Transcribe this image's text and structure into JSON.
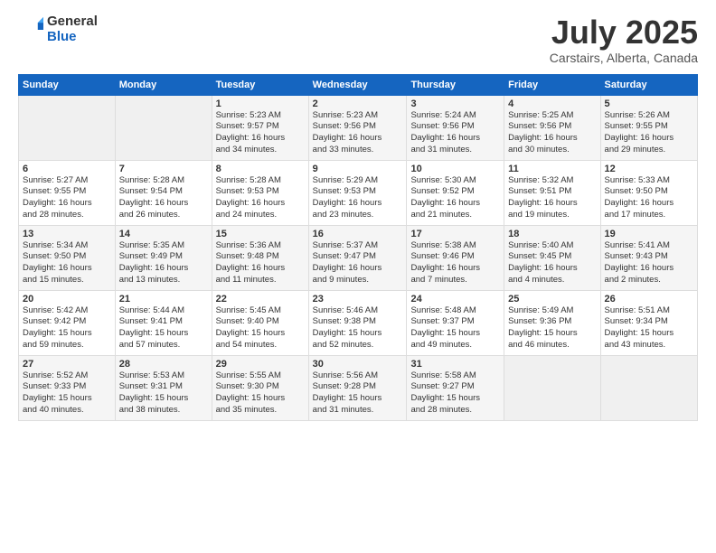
{
  "header": {
    "logo_general": "General",
    "logo_blue": "Blue",
    "title": "July 2025",
    "subtitle": "Carstairs, Alberta, Canada"
  },
  "calendar": {
    "days_of_week": [
      "Sunday",
      "Monday",
      "Tuesday",
      "Wednesday",
      "Thursday",
      "Friday",
      "Saturday"
    ],
    "weeks": [
      [
        {
          "day": "",
          "info": ""
        },
        {
          "day": "",
          "info": ""
        },
        {
          "day": "1",
          "info": "Sunrise: 5:23 AM\nSunset: 9:57 PM\nDaylight: 16 hours\nand 34 minutes."
        },
        {
          "day": "2",
          "info": "Sunrise: 5:23 AM\nSunset: 9:56 PM\nDaylight: 16 hours\nand 33 minutes."
        },
        {
          "day": "3",
          "info": "Sunrise: 5:24 AM\nSunset: 9:56 PM\nDaylight: 16 hours\nand 31 minutes."
        },
        {
          "day": "4",
          "info": "Sunrise: 5:25 AM\nSunset: 9:56 PM\nDaylight: 16 hours\nand 30 minutes."
        },
        {
          "day": "5",
          "info": "Sunrise: 5:26 AM\nSunset: 9:55 PM\nDaylight: 16 hours\nand 29 minutes."
        }
      ],
      [
        {
          "day": "6",
          "info": "Sunrise: 5:27 AM\nSunset: 9:55 PM\nDaylight: 16 hours\nand 28 minutes."
        },
        {
          "day": "7",
          "info": "Sunrise: 5:28 AM\nSunset: 9:54 PM\nDaylight: 16 hours\nand 26 minutes."
        },
        {
          "day": "8",
          "info": "Sunrise: 5:28 AM\nSunset: 9:53 PM\nDaylight: 16 hours\nand 24 minutes."
        },
        {
          "day": "9",
          "info": "Sunrise: 5:29 AM\nSunset: 9:53 PM\nDaylight: 16 hours\nand 23 minutes."
        },
        {
          "day": "10",
          "info": "Sunrise: 5:30 AM\nSunset: 9:52 PM\nDaylight: 16 hours\nand 21 minutes."
        },
        {
          "day": "11",
          "info": "Sunrise: 5:32 AM\nSunset: 9:51 PM\nDaylight: 16 hours\nand 19 minutes."
        },
        {
          "day": "12",
          "info": "Sunrise: 5:33 AM\nSunset: 9:50 PM\nDaylight: 16 hours\nand 17 minutes."
        }
      ],
      [
        {
          "day": "13",
          "info": "Sunrise: 5:34 AM\nSunset: 9:50 PM\nDaylight: 16 hours\nand 15 minutes."
        },
        {
          "day": "14",
          "info": "Sunrise: 5:35 AM\nSunset: 9:49 PM\nDaylight: 16 hours\nand 13 minutes."
        },
        {
          "day": "15",
          "info": "Sunrise: 5:36 AM\nSunset: 9:48 PM\nDaylight: 16 hours\nand 11 minutes."
        },
        {
          "day": "16",
          "info": "Sunrise: 5:37 AM\nSunset: 9:47 PM\nDaylight: 16 hours\nand 9 minutes."
        },
        {
          "day": "17",
          "info": "Sunrise: 5:38 AM\nSunset: 9:46 PM\nDaylight: 16 hours\nand 7 minutes."
        },
        {
          "day": "18",
          "info": "Sunrise: 5:40 AM\nSunset: 9:45 PM\nDaylight: 16 hours\nand 4 minutes."
        },
        {
          "day": "19",
          "info": "Sunrise: 5:41 AM\nSunset: 9:43 PM\nDaylight: 16 hours\nand 2 minutes."
        }
      ],
      [
        {
          "day": "20",
          "info": "Sunrise: 5:42 AM\nSunset: 9:42 PM\nDaylight: 15 hours\nand 59 minutes."
        },
        {
          "day": "21",
          "info": "Sunrise: 5:44 AM\nSunset: 9:41 PM\nDaylight: 15 hours\nand 57 minutes."
        },
        {
          "day": "22",
          "info": "Sunrise: 5:45 AM\nSunset: 9:40 PM\nDaylight: 15 hours\nand 54 minutes."
        },
        {
          "day": "23",
          "info": "Sunrise: 5:46 AM\nSunset: 9:38 PM\nDaylight: 15 hours\nand 52 minutes."
        },
        {
          "day": "24",
          "info": "Sunrise: 5:48 AM\nSunset: 9:37 PM\nDaylight: 15 hours\nand 49 minutes."
        },
        {
          "day": "25",
          "info": "Sunrise: 5:49 AM\nSunset: 9:36 PM\nDaylight: 15 hours\nand 46 minutes."
        },
        {
          "day": "26",
          "info": "Sunrise: 5:51 AM\nSunset: 9:34 PM\nDaylight: 15 hours\nand 43 minutes."
        }
      ],
      [
        {
          "day": "27",
          "info": "Sunrise: 5:52 AM\nSunset: 9:33 PM\nDaylight: 15 hours\nand 40 minutes."
        },
        {
          "day": "28",
          "info": "Sunrise: 5:53 AM\nSunset: 9:31 PM\nDaylight: 15 hours\nand 38 minutes."
        },
        {
          "day": "29",
          "info": "Sunrise: 5:55 AM\nSunset: 9:30 PM\nDaylight: 15 hours\nand 35 minutes."
        },
        {
          "day": "30",
          "info": "Sunrise: 5:56 AM\nSunset: 9:28 PM\nDaylight: 15 hours\nand 31 minutes."
        },
        {
          "day": "31",
          "info": "Sunrise: 5:58 AM\nSunset: 9:27 PM\nDaylight: 15 hours\nand 28 minutes."
        },
        {
          "day": "",
          "info": ""
        },
        {
          "day": "",
          "info": ""
        }
      ]
    ]
  }
}
